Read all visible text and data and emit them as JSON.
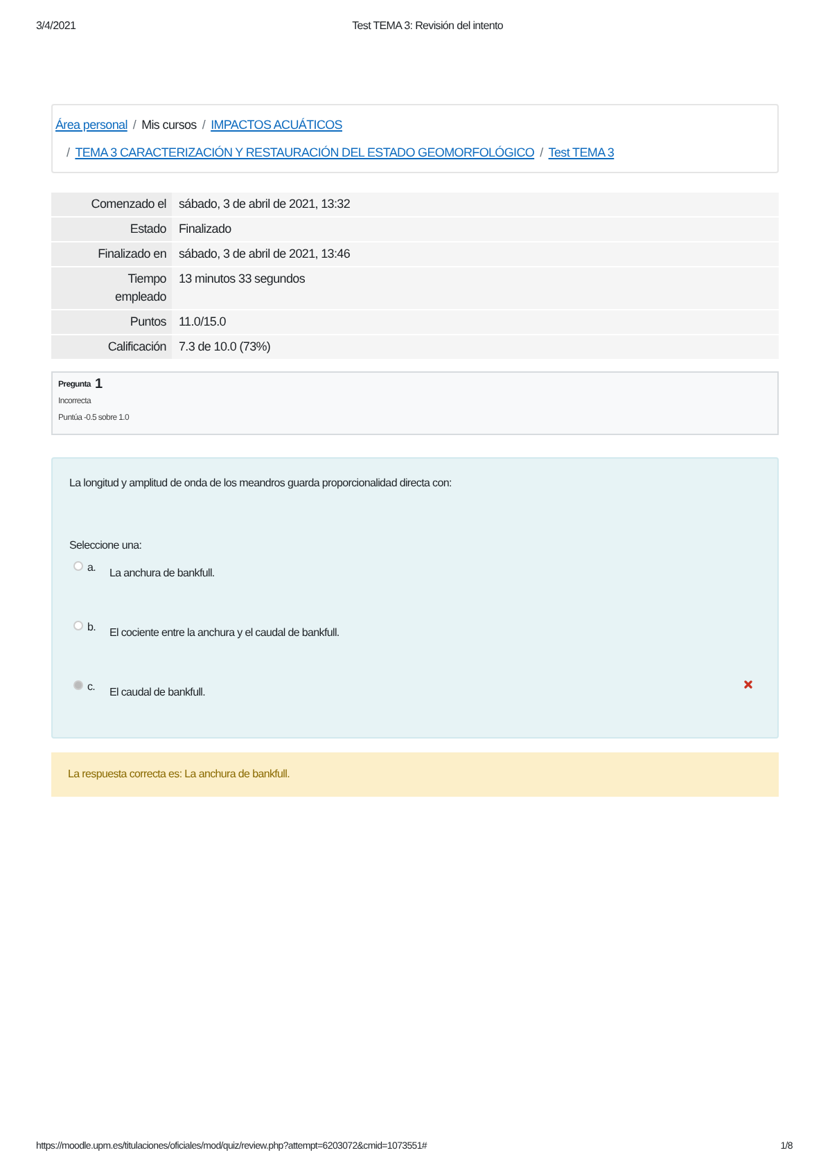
{
  "print_header": {
    "date": "3/4/2021",
    "title": "Test TEMA 3: Revisión del intento"
  },
  "breadcrumb": [
    {
      "label": "Área personal",
      "kind": "link"
    },
    {
      "separator": "/",
      "label": "Mis cursos",
      "kind": "text"
    },
    {
      "separator": "/",
      "label": "IMPACTOS ACUÁTICOS",
      "kind": "link"
    },
    {
      "separator": "/",
      "label": "TEMA 3 CARACTERIZACIÓN Y RESTAURACIÓN DEL ESTADO GEOMORFOLÓGICO",
      "kind": "link"
    },
    {
      "separator": "/",
      "label": "Test TEMA 3",
      "kind": "link"
    }
  ],
  "summary": [
    {
      "label": "Comenzado el",
      "value": "sábado, 3 de abril de 2021, 13:32"
    },
    {
      "label": "Estado",
      "value": "Finalizado"
    },
    {
      "label": "Finalizado en",
      "value": "sábado, 3 de abril de 2021, 13:46"
    },
    {
      "label": "Tiempo empleado",
      "value": "13 minutos 33 segundos"
    },
    {
      "label": "Puntos",
      "value": "11.0/15.0"
    },
    {
      "label": "Calificación",
      "value": "7.3 de 10.0 (73%)"
    }
  ],
  "question_info": {
    "label": "Pregunta",
    "number": "1",
    "state": "Incorrecta",
    "grade": "Puntúa -0.5 sobre 1.0"
  },
  "question": {
    "text": "La longitud y amplitud de onda de los meandros guarda proporcionalidad directa con:",
    "prompt": "Seleccione una:",
    "options": [
      {
        "letter": "a.",
        "text": "La anchura de bankfull.",
        "selected": false,
        "incorrect": false
      },
      {
        "letter": "b.",
        "text": "El cociente entre la anchura y el caudal de bankfull.",
        "selected": false,
        "incorrect": false
      },
      {
        "letter": "c.",
        "text": "El caudal de bankfull.",
        "selected": true,
        "incorrect": true
      }
    ]
  },
  "feedback": "La respuesta correcta es: La anchura de bankfull.",
  "print_footer": {
    "url": "https://moodle.upm.es/titulaciones/oficiales/mod/quiz/review.php?attempt=6203072&cmid=1073551#",
    "page": "1/8"
  }
}
